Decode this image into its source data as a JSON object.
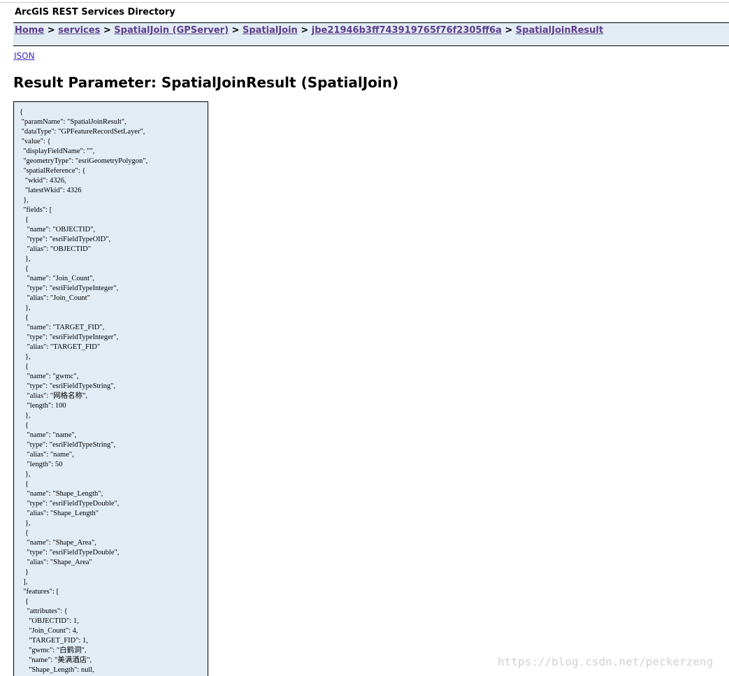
{
  "header": {
    "app_title": "ArcGIS REST Services Directory"
  },
  "breadcrumb": {
    "items": [
      "Home",
      "services",
      "SpatialJoin (GPServer)",
      "SpatialJoin",
      "jbe21946b3ff743919765f76f2305ff6a",
      "SpatialJoinResult"
    ],
    "separator": ">"
  },
  "links": {
    "json": "JSON"
  },
  "main": {
    "title": "Result Parameter: SpatialJoinResult (SpatialJoin)",
    "json_text": "{\n \"paramName\": \"SpatialJoinResult\",\n \"dataType\": \"GPFeatureRecordSetLayer\",\n \"value\": {\n  \"displayFieldName\": \"\",\n  \"geometryType\": \"esriGeometryPolygon\",\n  \"spatialReference\": {\n   \"wkid\": 4326,\n   \"latestWkid\": 4326\n  },\n  \"fields\": [\n   {\n    \"name\": \"OBJECTID\",\n    \"type\": \"esriFieldTypeOID\",\n    \"alias\": \"OBJECTID\"\n   },\n   {\n    \"name\": \"Join_Count\",\n    \"type\": \"esriFieldTypeInteger\",\n    \"alias\": \"Join_Count\"\n   },\n   {\n    \"name\": \"TARGET_FID\",\n    \"type\": \"esriFieldTypeInteger\",\n    \"alias\": \"TARGET_FID\"\n   },\n   {\n    \"name\": \"gwmc\",\n    \"type\": \"esriFieldTypeString\",\n    \"alias\": \"网格名称\",\n    \"length\": 100\n   },\n   {\n    \"name\": \"name\",\n    \"type\": \"esriFieldTypeString\",\n    \"alias\": \"name\",\n    \"length\": 50\n   },\n   {\n    \"name\": \"Shape_Length\",\n    \"type\": \"esriFieldTypeDouble\",\n    \"alias\": \"Shape_Length\"\n   },\n   {\n    \"name\": \"Shape_Area\",\n    \"type\": \"esriFieldTypeDouble\",\n    \"alias\": \"Shape_Area\"\n   }\n  ],\n  \"features\": [\n   {\n    \"attributes\": {\n     \"OBJECTID\": 1,\n     \"Join_Count\": 4,\n     \"TARGET_FID\": 1,\n     \"gwmc\": \"白鹤洞\",\n     \"name\": \"美满酒店\",\n     \"Shape_Length\": null,"
  },
  "watermark": "https://blog.csdn.net/peckerzeng",
  "colors": {
    "panel_bg": "#e2ecf4",
    "visited_link": "#5c3e8c",
    "link": "#3a29c4"
  }
}
